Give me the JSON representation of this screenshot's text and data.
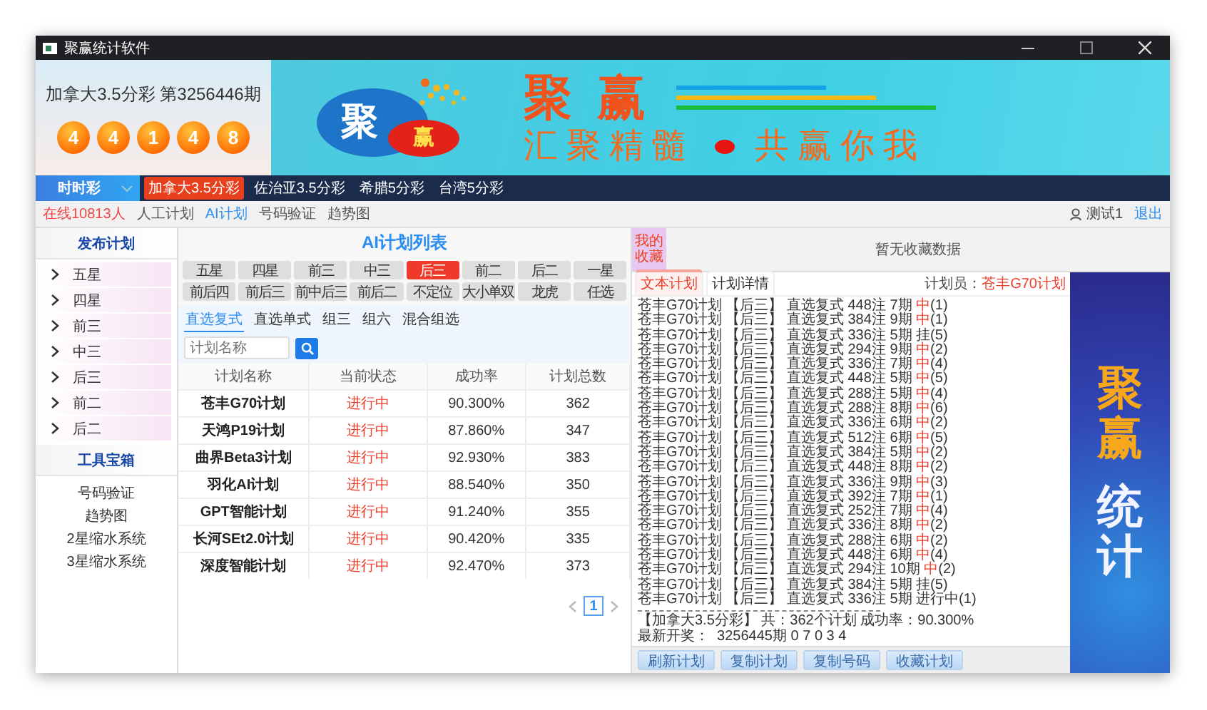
{
  "window": {
    "title": "聚赢统计软件"
  },
  "draw": {
    "title": "加拿大3.5分彩 第3256446期",
    "balls": [
      "4",
      "4",
      "1",
      "4",
      "8"
    ]
  },
  "banner": {
    "logo_text": "聚",
    "logo_badge": "赢",
    "headline": "聚 赢",
    "slogan_left": "汇聚精髓",
    "slogan_right": "共赢你我"
  },
  "category": {
    "label": "时时彩"
  },
  "lottery_tabs": [
    {
      "label": "加拿大3.5分彩",
      "selected": true
    },
    {
      "label": "佐治亚3.5分彩",
      "selected": false
    },
    {
      "label": "希腊5分彩",
      "selected": false
    },
    {
      "label": "台湾5分彩",
      "selected": false
    }
  ],
  "sub_nav": {
    "online": "在线10813人",
    "links": [
      {
        "label": "人工计划",
        "selected": false
      },
      {
        "label": "AI计划",
        "selected": true
      },
      {
        "label": "号码验证",
        "selected": false
      },
      {
        "label": "趋势图",
        "selected": false
      }
    ],
    "user": "测试1",
    "logout": "退出"
  },
  "publish": {
    "title": "发布计划",
    "items": [
      "五星",
      "四星",
      "前三",
      "中三",
      "后三",
      "前二",
      "后二"
    ]
  },
  "toolbox": {
    "title": "工具宝箱",
    "items": [
      "号码验证",
      "趋势图",
      "2星缩水系统",
      "3星缩水系统"
    ]
  },
  "ai_plans": {
    "title": "AI计划列表",
    "positions": [
      {
        "label": "五星",
        "selected": false
      },
      {
        "label": "四星",
        "selected": false
      },
      {
        "label": "前三",
        "selected": false
      },
      {
        "label": "中三",
        "selected": false
      },
      {
        "label": "后三",
        "selected": true
      },
      {
        "label": "前二",
        "selected": false
      },
      {
        "label": "后二",
        "selected": false
      },
      {
        "label": "一星",
        "selected": false
      },
      {
        "label": "前后四",
        "selected": false
      },
      {
        "label": "前后三",
        "selected": false
      },
      {
        "label": "前中后三",
        "selected": false
      },
      {
        "label": "前后二",
        "selected": false
      },
      {
        "label": "不定位",
        "selected": false
      },
      {
        "label": "大小单双",
        "selected": false
      },
      {
        "label": "龙虎",
        "selected": false
      },
      {
        "label": "任选",
        "selected": false
      }
    ],
    "methods": [
      {
        "label": "直选复式",
        "selected": true
      },
      {
        "label": "直选单式",
        "selected": false
      },
      {
        "label": "组三",
        "selected": false
      },
      {
        "label": "组六",
        "selected": false
      },
      {
        "label": "混合组选",
        "selected": false
      }
    ],
    "search": {
      "placeholder": "计划名称"
    },
    "columns": [
      "计划名称",
      "当前状态",
      "成功率",
      "计划总数"
    ],
    "rows": [
      {
        "name": "苍丰G70计划",
        "status": "进行中",
        "rate": "90.300%",
        "total": "362"
      },
      {
        "name": "天鸿P19计划",
        "status": "进行中",
        "rate": "87.860%",
        "total": "347"
      },
      {
        "name": "曲界Beta3计划",
        "status": "进行中",
        "rate": "92.930%",
        "total": "383"
      },
      {
        "name": "羽化AI计划",
        "status": "进行中",
        "rate": "88.540%",
        "total": "350"
      },
      {
        "name": "GPT智能计划",
        "status": "进行中",
        "rate": "91.240%",
        "total": "355"
      },
      {
        "name": "长河SEt2.0计划",
        "status": "进行中",
        "rate": "90.420%",
        "total": "335"
      },
      {
        "name": "深度智能计划",
        "status": "进行中",
        "rate": "92.470%",
        "total": "373"
      }
    ],
    "pages": [
      {
        "label": "1",
        "selected": true
      }
    ]
  },
  "favorites": {
    "label": "我的收藏",
    "empty": "暂无收藏数据"
  },
  "detail": {
    "tabs": [
      {
        "label": "文本计划",
        "selected": true
      },
      {
        "label": "计划详情",
        "selected": false
      }
    ],
    "planner_label": "计划员：",
    "planner": "苍丰G70计划",
    "lines": [
      {
        "text": "苍丰G70计划 【后三】 直选复式 448注 7期",
        "result": "中",
        "hit": true,
        "count": "(1)"
      },
      {
        "text": "苍丰G70计划 【后三】 直选复式 384注 9期",
        "result": "中",
        "hit": true,
        "count": "(1)"
      },
      {
        "text": "苍丰G70计划 【后三】 直选复式 336注 5期",
        "result": "挂",
        "hit": false,
        "count": "(5)"
      },
      {
        "text": "苍丰G70计划 【后三】 直选复式 294注 9期",
        "result": "中",
        "hit": true,
        "count": "(2)"
      },
      {
        "text": "苍丰G70计划 【后三】 直选复式 336注 7期",
        "result": "中",
        "hit": true,
        "count": "(4)"
      },
      {
        "text": "苍丰G70计划 【后三】 直选复式 448注 5期",
        "result": "中",
        "hit": true,
        "count": "(5)"
      },
      {
        "text": "苍丰G70计划 【后三】 直选复式 288注 5期",
        "result": "中",
        "hit": true,
        "count": "(4)"
      },
      {
        "text": "苍丰G70计划 【后三】 直选复式 288注 8期",
        "result": "中",
        "hit": true,
        "count": "(6)"
      },
      {
        "text": "苍丰G70计划 【后三】 直选复式 336注 6期",
        "result": "中",
        "hit": true,
        "count": "(2)"
      },
      {
        "text": "苍丰G70计划 【后三】 直选复式 512注 6期",
        "result": "中",
        "hit": true,
        "count": "(5)"
      },
      {
        "text": "苍丰G70计划 【后三】 直选复式 384注 5期",
        "result": "中",
        "hit": true,
        "count": "(2)"
      },
      {
        "text": "苍丰G70计划 【后三】 直选复式 448注 8期",
        "result": "中",
        "hit": true,
        "count": "(2)"
      },
      {
        "text": "苍丰G70计划 【后三】 直选复式 336注 9期",
        "result": "中",
        "hit": true,
        "count": "(3)"
      },
      {
        "text": "苍丰G70计划 【后三】 直选复式 392注 7期",
        "result": "中",
        "hit": true,
        "count": "(1)"
      },
      {
        "text": "苍丰G70计划 【后三】 直选复式 252注 7期",
        "result": "中",
        "hit": true,
        "count": "(4)"
      },
      {
        "text": "苍丰G70计划 【后三】 直选复式 336注 8期",
        "result": "中",
        "hit": true,
        "count": "(2)"
      },
      {
        "text": "苍丰G70计划 【后三】 直选复式 288注 6期",
        "result": "中",
        "hit": true,
        "count": "(2)"
      },
      {
        "text": "苍丰G70计划 【后三】 直选复式 448注 6期",
        "result": "中",
        "hit": true,
        "count": "(4)"
      },
      {
        "text": "苍丰G70计划 【后三】 直选复式 294注 10期",
        "result": "中",
        "hit": true,
        "count": "(2)"
      },
      {
        "text": "苍丰G70计划 【后三】 直选复式 384注 5期",
        "result": "挂",
        "hit": false,
        "count": "(5)"
      },
      {
        "text": "苍丰G70计划 【后三】 直选复式 336注 5期",
        "result": "进行中",
        "hit": false,
        "count": "(1)"
      }
    ],
    "summary": "【加拿大3.5分彩】 共：362个计划 成功率：90.300%",
    "latest": "最新开奖：  3256445期 0 7 0 3 4",
    "buttons": [
      "刷新计划",
      "复制计划",
      "复制号码",
      "收藏计划"
    ]
  },
  "ad": {
    "lines": [
      {
        "text": "聚赢",
        "kind": "accent"
      },
      {
        "text": "统计",
        "kind": "plain"
      }
    ]
  }
}
